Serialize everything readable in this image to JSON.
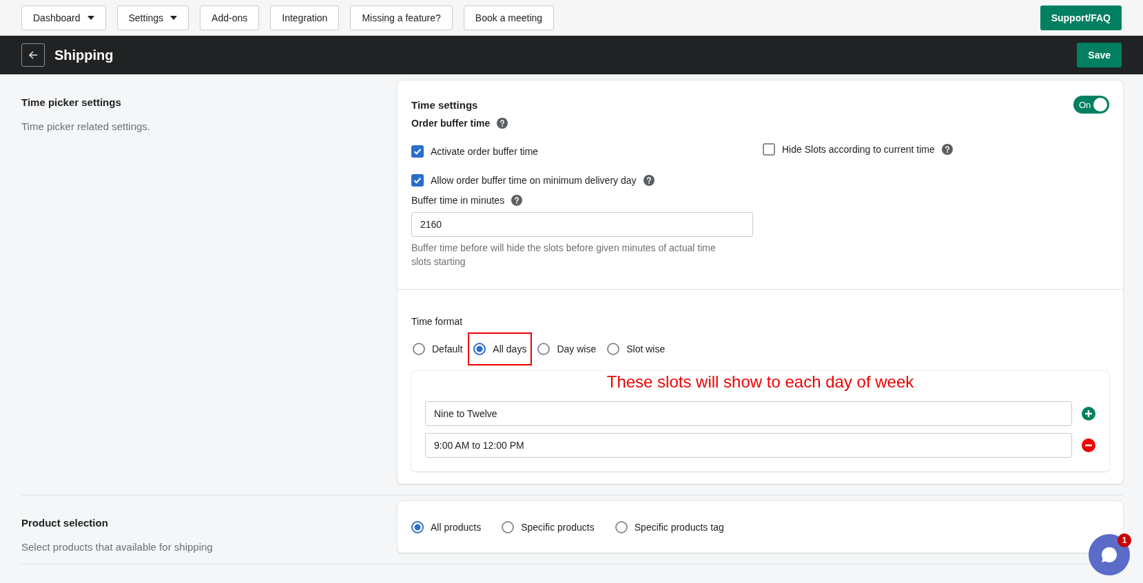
{
  "top_nav": {
    "buttons": [
      {
        "label": "Dashboard",
        "dropdown": true
      },
      {
        "label": "Settings",
        "dropdown": true
      },
      {
        "label": "Add-ons",
        "dropdown": false
      },
      {
        "label": "Integration",
        "dropdown": false
      },
      {
        "label": "Missing a feature?",
        "dropdown": false
      },
      {
        "label": "Book a meeting",
        "dropdown": false
      }
    ],
    "support_button": "Support/FAQ"
  },
  "header": {
    "title": "Shipping",
    "save_button": "Save"
  },
  "time_picker": {
    "title": "Time picker settings",
    "description": "Time picker related settings.",
    "card": {
      "title": "Time settings",
      "toggle": {
        "label": "On",
        "on": true
      },
      "order_buffer_label": "Order buffer time",
      "checkboxes": [
        {
          "label": "Activate order buffer time",
          "checked": true,
          "help": false
        },
        {
          "label": "Allow order buffer time on minimum delivery day",
          "checked": true,
          "help": true
        }
      ],
      "hide_slots": {
        "label": "Hide Slots according to current time",
        "checked": false,
        "help": true
      },
      "buffer_field": {
        "label": "Buffer time in minutes",
        "value": "2160"
      },
      "hint": "Buffer time before will hide the slots before given minutes of actual time slots starting",
      "time_format": {
        "label": "Time format",
        "options": [
          {
            "label": "Default",
            "selected": false,
            "highlighted": false
          },
          {
            "label": "All days",
            "selected": true,
            "highlighted": true
          },
          {
            "label": "Day wise",
            "selected": false,
            "highlighted": false
          },
          {
            "label": "Slot wise",
            "selected": false,
            "highlighted": false
          }
        ]
      },
      "annotation": "These slots will show to each day of week",
      "slots": [
        {
          "value": "Nine to Twelve",
          "kind": "add"
        },
        {
          "value": "9:00 AM to 12:00 PM",
          "kind": "remove"
        }
      ]
    }
  },
  "product_selection": {
    "title": "Product selection",
    "description": "Select products that available for shipping",
    "options": [
      {
        "label": "All products",
        "selected": true
      },
      {
        "label": "Specific products",
        "selected": false
      },
      {
        "label": "Specific products tag",
        "selected": false
      }
    ]
  },
  "chat": {
    "badge": "1"
  }
}
